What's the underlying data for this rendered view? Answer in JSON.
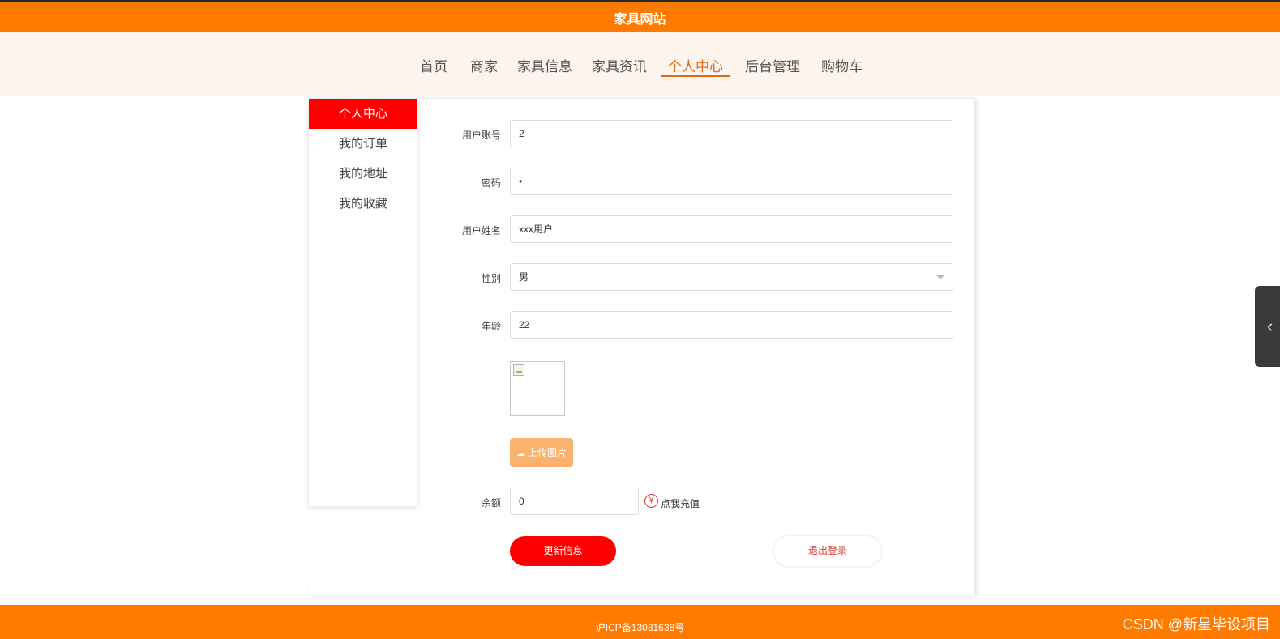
{
  "header": {
    "site_title": "家具网站"
  },
  "nav": {
    "items": [
      "首页",
      "商家",
      "家具信息",
      "家具资讯",
      "个人中心",
      "后台管理",
      "购物车"
    ],
    "active_index": 4
  },
  "sidebar": {
    "items": [
      "个人中心",
      "我的订单",
      "我的地址",
      "我的收藏"
    ],
    "active_index": 0
  },
  "form": {
    "account_label": "用户账号",
    "account_value": "2",
    "password_label": "密码",
    "password_value": "•",
    "name_label": "用户姓名",
    "name_value": "xxx用户",
    "gender_label": "性别",
    "gender_value": "男",
    "age_label": "年龄",
    "age_value": "22",
    "upload_label": "上传图片",
    "balance_label": "余额",
    "balance_value": "0",
    "recharge_label": "点我充值",
    "update_button": "更新信息",
    "logout_button": "退出登录"
  },
  "footer": {
    "icp": "沪ICP备13031638号"
  },
  "watermark": "CSDN @新星毕设项目",
  "colors": {
    "brand_orange": "#ff7a00",
    "accent_red": "#ff0000",
    "nav_active": "#e36a12",
    "upload_btn": "#f9b36e"
  },
  "icons": {
    "upload": "cloud-upload-icon",
    "recharge": "yen-icon",
    "side_tab": "chevron-left-icon"
  }
}
